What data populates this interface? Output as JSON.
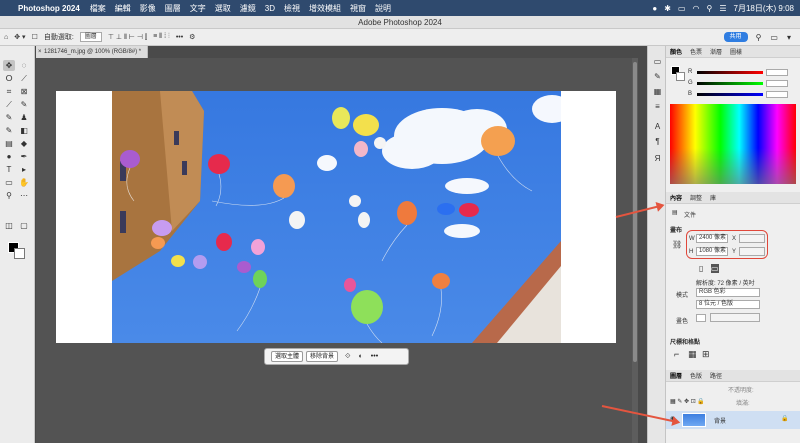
{
  "menubar": {
    "app": "Photoshop 2024",
    "items": [
      "檔案",
      "編輯",
      "影像",
      "圖層",
      "文字",
      "選取",
      "濾鏡",
      "3D",
      "檢視",
      "增效模組",
      "視窗",
      "說明"
    ],
    "clock": "7月18日(木) 9:08"
  },
  "window": {
    "title": "Adobe Photoshop 2024"
  },
  "options": {
    "auto_select": "自動選取:",
    "target": "圖層",
    "share": "共用"
  },
  "document": {
    "tab": "1281746_m.jpg @ 100% (RGB/8#) *"
  },
  "contextbar": {
    "select_subject": "選取主體",
    "remove_bg": "移除背景"
  },
  "color_panel": {
    "tabs": [
      "顏色",
      "色票",
      "漸層",
      "圖樣"
    ],
    "channels": [
      "R",
      "G",
      "B"
    ]
  },
  "properties_panel": {
    "tabs": [
      "內容",
      "調整",
      "庫"
    ],
    "doc_label": "文件",
    "canvas_section": "畫布",
    "w_label": "W",
    "w_value": "2400 像素",
    "h_label": "H",
    "h_value": "1080 像素",
    "x_label": "X",
    "y_label": "Y",
    "resolution": "解析度: 72 像素 / 英吋",
    "mode_label": "模式",
    "mode_value": "RGB 色彩",
    "depth_value": "8 位元 / 色版",
    "bg_label": "畫色",
    "guides_section": "尺標和格點"
  },
  "layers_panel": {
    "tabs": [
      "圖層",
      "色版",
      "路徑"
    ],
    "opacity_label": "不透明度:",
    "fill_label": "填滿:",
    "layer_name": "背景"
  },
  "colors": {
    "accent": "#2f7de1",
    "annotation": "#e0473a",
    "sky": "#3a7fe0"
  }
}
